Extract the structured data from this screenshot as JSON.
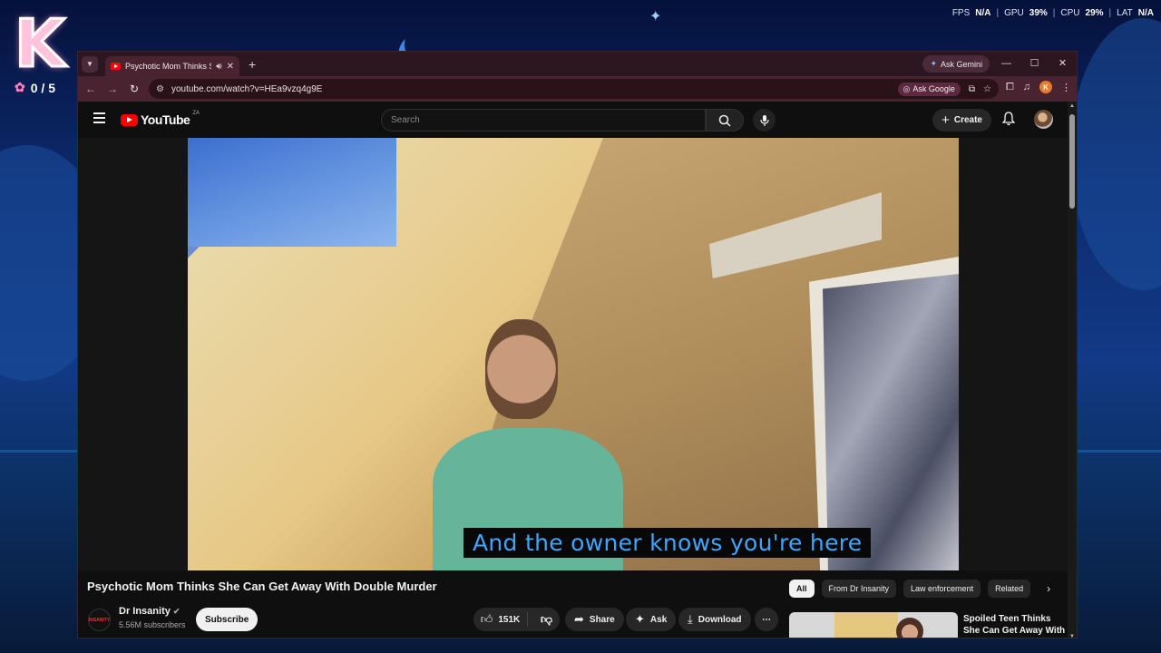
{
  "desktop": {
    "counter": "0 / 5",
    "perf": {
      "fps_label": "FPS",
      "fps_value": "N/A",
      "gpu_label": "GPU",
      "gpu_value": "39%",
      "cpu_label": "CPU",
      "cpu_value": "29%",
      "lat_label": "LAT",
      "lat_value": "N/A"
    },
    "logo_letter": "K"
  },
  "browser": {
    "tab_title": "Psychotic Mom Thinks She Can Get Away With Double Murder",
    "gemini_label": "Ask Gemini",
    "url": "youtube.com/watch?v=HEa9vzq4g9E",
    "ask_google_label": "Ask Google",
    "profile_initial": "K"
  },
  "youtube": {
    "logo_text": "YouTube",
    "country_code": "ZA",
    "search_placeholder": "Search",
    "create_label": "Create",
    "subtitle": "And the owner knows you're here",
    "video_title": "Psychotic Mom Thinks She Can Get Away With Double Murder",
    "channel": {
      "name": "Dr Insanity",
      "subscribers": "5.56M subscribers",
      "avatar_text": "INSANITY"
    },
    "subscribe_label": "Subscribe",
    "actions": {
      "likes": "151K",
      "share": "Share",
      "ask": "Ask",
      "download": "Download"
    },
    "chips": [
      "All",
      "From Dr Insanity",
      "Law enforcement",
      "Related"
    ],
    "recommendation": {
      "title": "Spoiled Teen Thinks She Can Get Away With Murder"
    }
  },
  "colors": {
    "subtitle_text": "#3ea6ff",
    "youtube_red": "#ff0000",
    "browser_frame": "#4a2331"
  }
}
